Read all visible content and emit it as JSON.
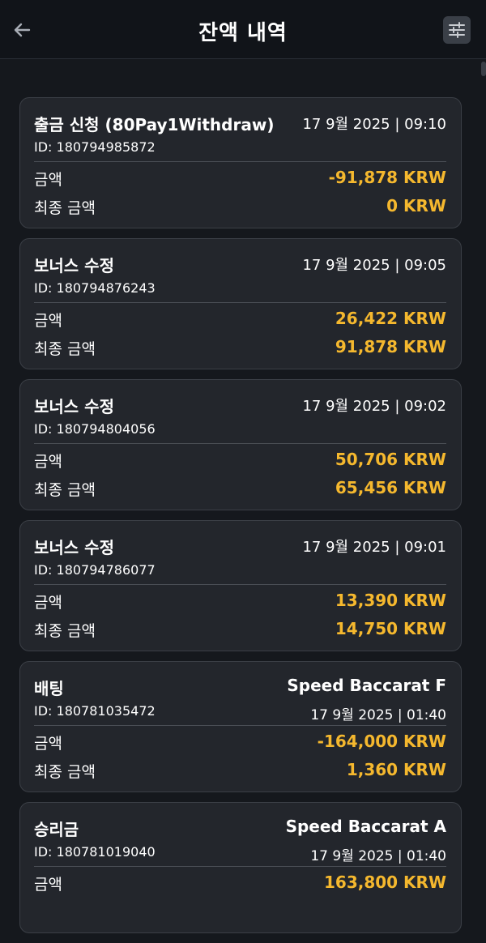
{
  "header": {
    "title": "잔액 내역",
    "back_icon": "arrow-left-icon",
    "filter_icon": "sliders-icon"
  },
  "colors": {
    "accent": "#f5b82e",
    "background": "#15181d",
    "card": "#23262c"
  },
  "transactions": [
    {
      "type": "출금 신청 (80Pay1Withdraw)",
      "id": "ID: 180794985872",
      "game": "",
      "datetime": "17 9월 2025 | 09:10",
      "amount_label": "금액",
      "amount": "-91,878 KRW",
      "final_label": "최종 금액",
      "final": "0 KRW"
    },
    {
      "type": "보너스 수정",
      "id": "ID: 180794876243",
      "game": "",
      "datetime": "17 9월 2025 | 09:05",
      "amount_label": "금액",
      "amount": "26,422 KRW",
      "final_label": "최종 금액",
      "final": "91,878 KRW"
    },
    {
      "type": "보너스 수정",
      "id": "ID: 180794804056",
      "game": "",
      "datetime": "17 9월 2025 | 09:02",
      "amount_label": "금액",
      "amount": "50,706 KRW",
      "final_label": "최종 금액",
      "final": "65,456 KRW"
    },
    {
      "type": "보너스 수정",
      "id": "ID: 180794786077",
      "game": "",
      "datetime": "17 9월 2025 | 09:01",
      "amount_label": "금액",
      "amount": "13,390 KRW",
      "final_label": "최종 금액",
      "final": "14,750 KRW"
    },
    {
      "type": "배팅",
      "id": "ID: 180781035472",
      "game": "Speed Baccarat F",
      "datetime": "17 9월 2025 | 01:40",
      "amount_label": "금액",
      "amount": "-164,000 KRW",
      "final_label": "최종 금액",
      "final": "1,360 KRW"
    },
    {
      "type": "승리금",
      "id": "ID: 180781019040",
      "game": "Speed Baccarat A",
      "datetime": "17 9월 2025 | 01:40",
      "amount_label": "금액",
      "amount": "163,800 KRW",
      "final_label": "",
      "final": ""
    }
  ]
}
